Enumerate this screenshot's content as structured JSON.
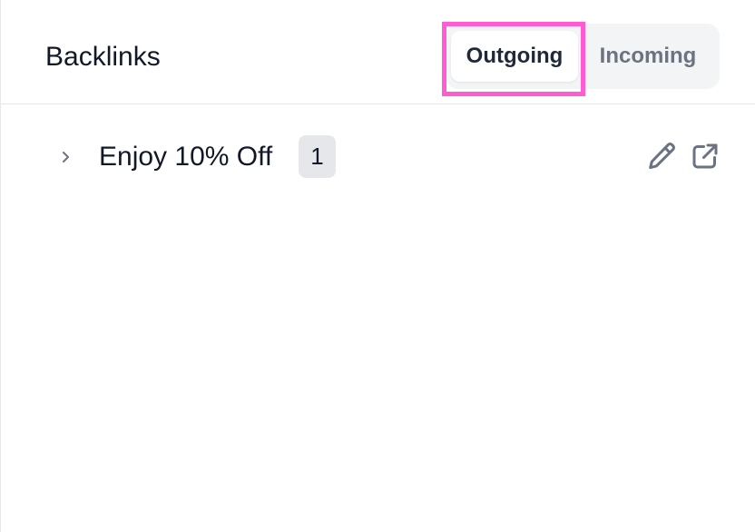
{
  "header": {
    "title": "Backlinks",
    "tabs": [
      {
        "label": "Outgoing",
        "active": true
      },
      {
        "label": "Incoming",
        "active": false
      }
    ]
  },
  "links": [
    {
      "label": "Enjoy 10% Off",
      "count": "1",
      "icons": [
        "chevron-right-icon",
        "pencil-icon",
        "external-link-icon"
      ]
    }
  ],
  "colors": {
    "highlight": "#ff5bd3",
    "tab_bg": "#f3f4f6",
    "badge_bg": "#e5e7eb",
    "icon": "#6b7280"
  }
}
